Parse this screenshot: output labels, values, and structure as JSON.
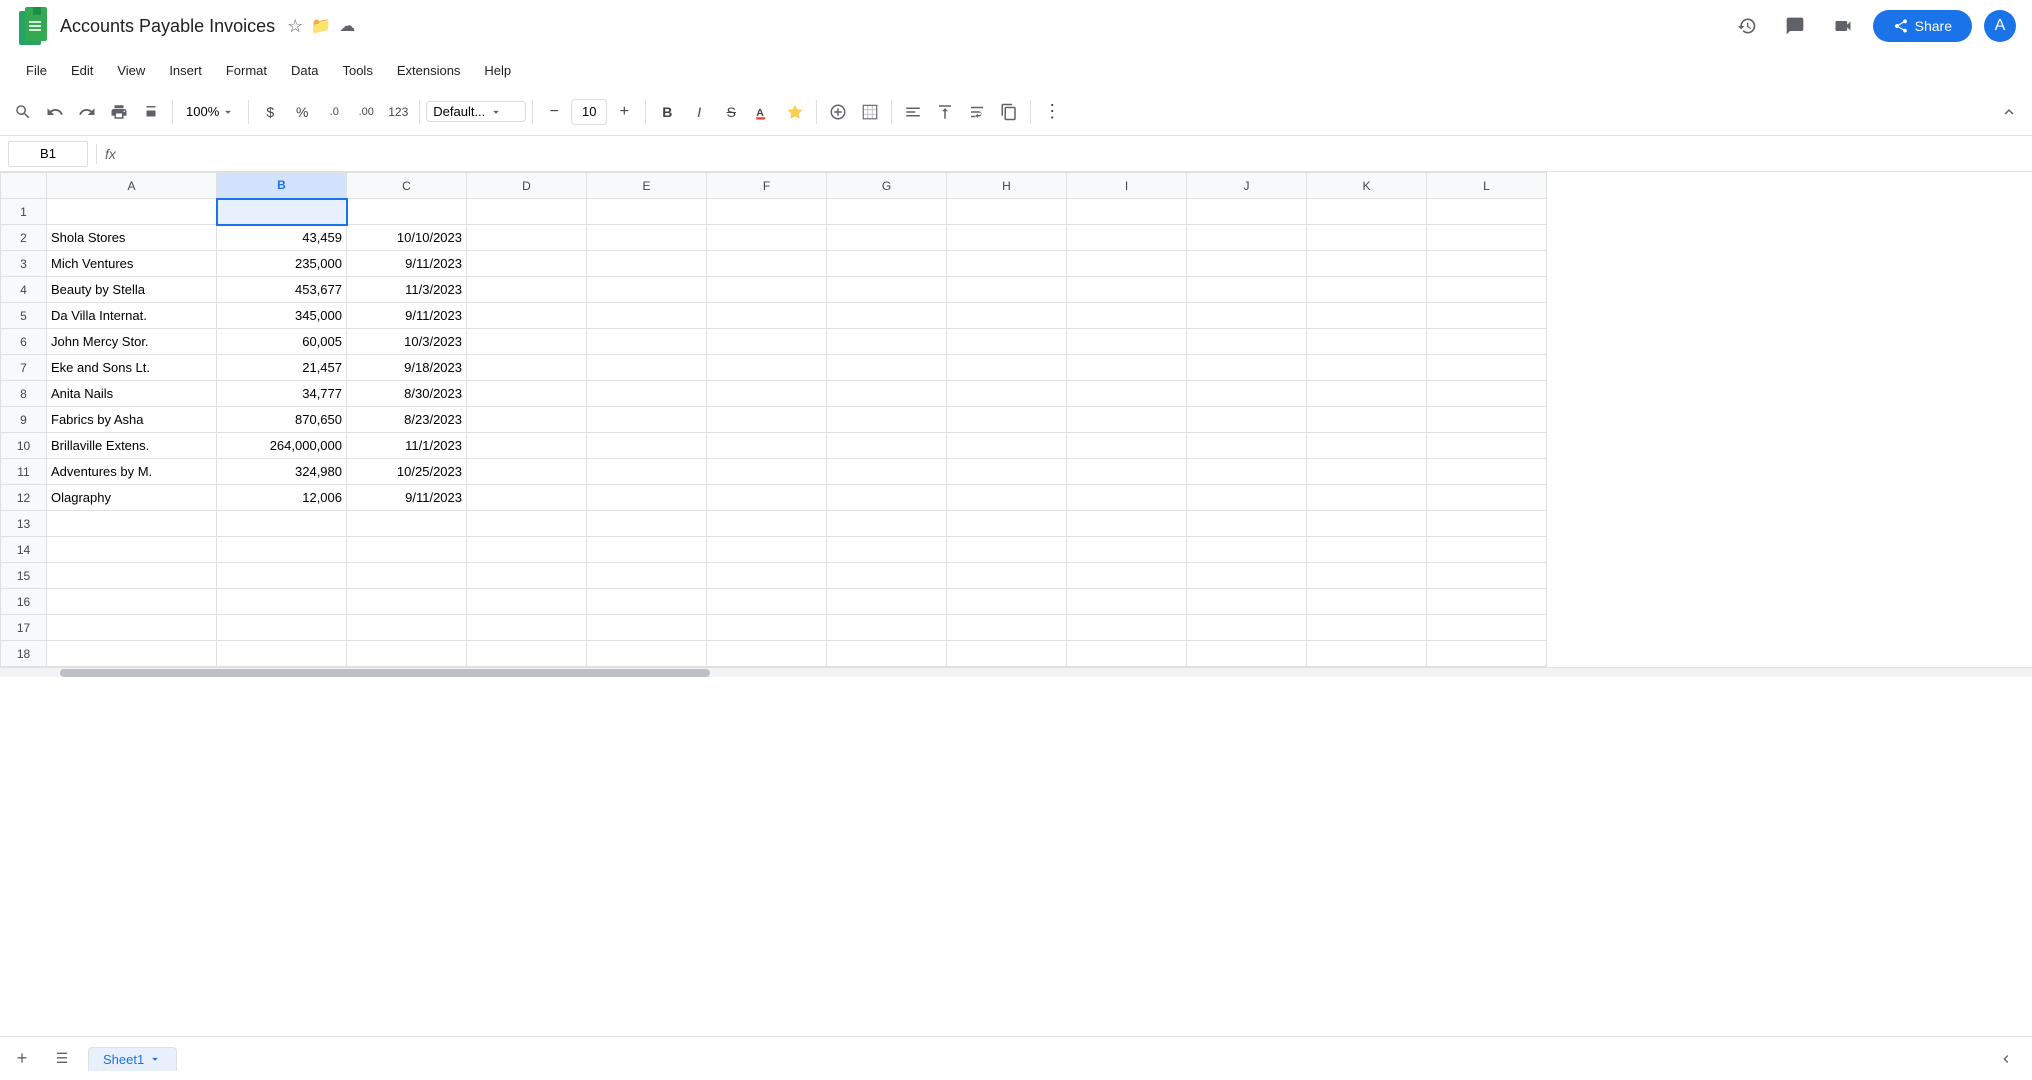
{
  "app": {
    "title": "Accounts Payable Invoices",
    "logo_text": "S",
    "logo_color": "#34a853"
  },
  "title_icons": {
    "star": "☆",
    "folder": "📁",
    "cloud": "☁"
  },
  "menu": {
    "items": [
      "File",
      "Edit",
      "View",
      "Insert",
      "Format",
      "Data",
      "Tools",
      "Extensions",
      "Help"
    ]
  },
  "toolbar": {
    "zoom": "100%",
    "font_name": "Default...",
    "font_size": "10",
    "currency": "$",
    "percent": "%",
    "dec_decrease": ".0",
    "dec_increase": ".00",
    "num_format": "123"
  },
  "formula_bar": {
    "cell_ref": "B1",
    "fx_label": "fx"
  },
  "columns": [
    "",
    "A",
    "B",
    "C",
    "D",
    "E",
    "F",
    "G",
    "H",
    "I",
    "J",
    "K",
    "L"
  ],
  "rows": [
    {
      "num": 1,
      "a": "",
      "b": "",
      "c": ""
    },
    {
      "num": 2,
      "a": "Shola Stores",
      "b": "43,459",
      "c": "10/10/2023"
    },
    {
      "num": 3,
      "a": "Mich Ventures",
      "b": "235,000",
      "c": "9/11/2023"
    },
    {
      "num": 4,
      "a": "Beauty by Stella",
      "b": "453,677",
      "c": "11/3/2023"
    },
    {
      "num": 5,
      "a": "Da Villa Internat.",
      "b": "345,000",
      "c": "9/11/2023"
    },
    {
      "num": 6,
      "a": "John Mercy Stor.",
      "b": "60,005",
      "c": "10/3/2023"
    },
    {
      "num": 7,
      "a": "Eke and Sons Lt.",
      "b": "21,457",
      "c": "9/18/2023"
    },
    {
      "num": 8,
      "a": "Anita Nails",
      "b": "34,777",
      "c": "8/30/2023"
    },
    {
      "num": 9,
      "a": "Fabrics by Asha",
      "b": "870,650",
      "c": "8/23/2023"
    },
    {
      "num": 10,
      "a": "Brillaville Extens.",
      "b": "264,000,000",
      "c": "11/1/2023"
    },
    {
      "num": 11,
      "a": "Adventures by M.",
      "b": "324,980",
      "c": "10/25/2023"
    },
    {
      "num": 12,
      "a": "Olagraphy",
      "b": "12,006",
      "c": "9/11/2023"
    },
    {
      "num": 13,
      "a": "",
      "b": "",
      "c": ""
    },
    {
      "num": 14,
      "a": "",
      "b": "",
      "c": ""
    },
    {
      "num": 15,
      "a": "",
      "b": "",
      "c": ""
    },
    {
      "num": 16,
      "a": "",
      "b": "",
      "c": ""
    },
    {
      "num": 17,
      "a": "",
      "b": "",
      "c": ""
    },
    {
      "num": 18,
      "a": "",
      "b": "",
      "c": ""
    }
  ],
  "sheet": {
    "name": "Sheet1",
    "add_label": "+"
  },
  "share_button": "Share",
  "colors": {
    "selected_cell_border": "#1a73e8",
    "selected_col_header": "#d3e3fd",
    "google_green": "#34a853"
  }
}
